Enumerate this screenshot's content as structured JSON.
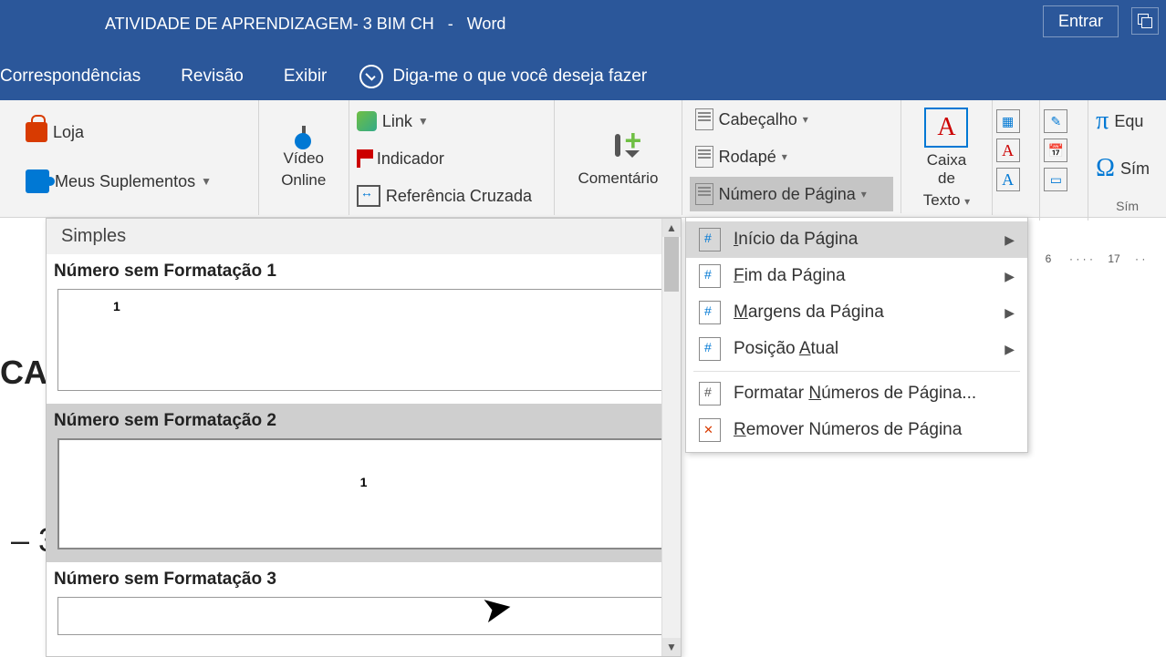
{
  "title": {
    "doc": "ATIVIDADE DE APRENDIZAGEM- 3 BIM CH",
    "app": "Word"
  },
  "signin": "Entrar",
  "tabs": {
    "correspondencias": "Correspondências",
    "revisao": "Revisão",
    "exibir": "Exibir",
    "tellme": "Diga-me o que você deseja fazer"
  },
  "ribbon": {
    "loja": "Loja",
    "suplementos": "Meus Suplementos",
    "video1": "Vídeo",
    "video2": "Online",
    "link": "Link",
    "indicador": "Indicador",
    "refcruzada": "Referência Cruzada",
    "comentario": "Comentário",
    "cabecalho": "Cabeçalho",
    "rodape": "Rodapé",
    "numpagina": "Número de Página",
    "caixatexto1": "Caixa de",
    "caixatexto2": "Texto",
    "equacao": "Equ",
    "simbolo": "Sím",
    "simgroup": "Sím"
  },
  "submenu": {
    "inicio": "Início da Página",
    "fim": "Fim da Página",
    "margens": "Margens da Página",
    "posicao": "Posição Atual",
    "formatar": "Formatar Números de Página...",
    "remover": "Remover Números de Página"
  },
  "gallery": {
    "header": "Simples",
    "item1": "Número sem Formatação 1",
    "item2": "Número sem Formatação 2",
    "item3": "Número sem Formatação 3",
    "num": "1"
  },
  "ruler": {
    "a": "6",
    "b": "17"
  },
  "doc": {
    "frag1": "CA",
    "frag2": "– 3"
  }
}
